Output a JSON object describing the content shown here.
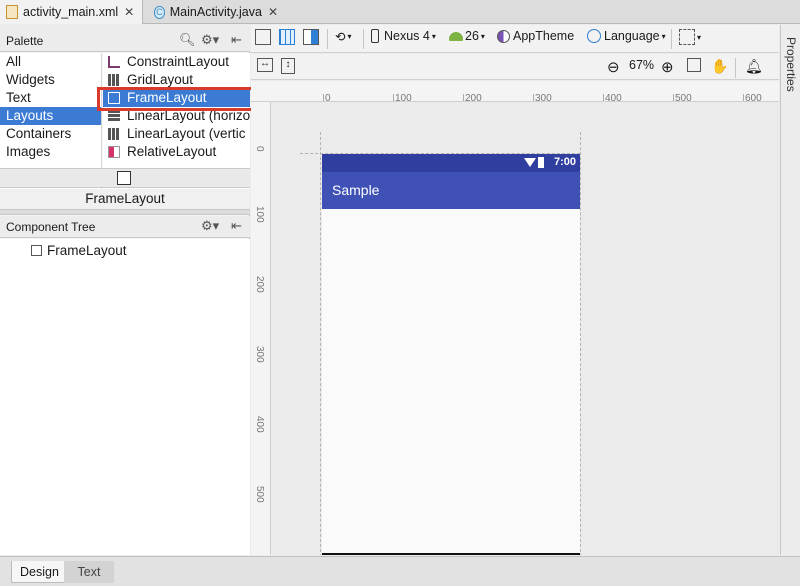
{
  "tabs": [
    {
      "label": "activity_main.xml",
      "icon": "xml-file-icon",
      "active": true
    },
    {
      "label": "MainActivity.java",
      "icon": "java-class-icon",
      "active": false
    }
  ],
  "palette": {
    "title": "Palette",
    "categories": [
      "All",
      "Widgets",
      "Text",
      "Layouts",
      "Containers",
      "Images"
    ],
    "selected_category": "Layouts",
    "items": [
      "ConstraintLayout",
      "GridLayout",
      "FrameLayout",
      "LinearLayout (horizo",
      "LinearLayout (vertic",
      "RelativeLayout"
    ],
    "selected_item": "FrameLayout",
    "preview_label": "FrameLayout"
  },
  "component_tree": {
    "title": "Component Tree",
    "items": [
      "FrameLayout"
    ]
  },
  "toolbar": {
    "device": "Nexus 4",
    "api_level": "26",
    "theme": "AppTheme",
    "language": "Language",
    "zoom": "67%"
  },
  "ruler": {
    "top": [
      "0",
      "100",
      "200",
      "300",
      "400",
      "500",
      "600"
    ],
    "left": [
      "0",
      "100",
      "200",
      "300",
      "400",
      "500"
    ]
  },
  "device_preview": {
    "time": "7:00",
    "app_title": "Sample",
    "statusbar_color": "#303f9f",
    "appbar_color": "#3f51b5"
  },
  "right_panel": {
    "label": "Properties"
  },
  "bottom_tabs": [
    {
      "label": "Design",
      "active": true
    },
    {
      "label": "Text",
      "active": false
    }
  ],
  "colors": {
    "selection": "#3b7bd4",
    "highlight_box": "#d93a2c"
  }
}
